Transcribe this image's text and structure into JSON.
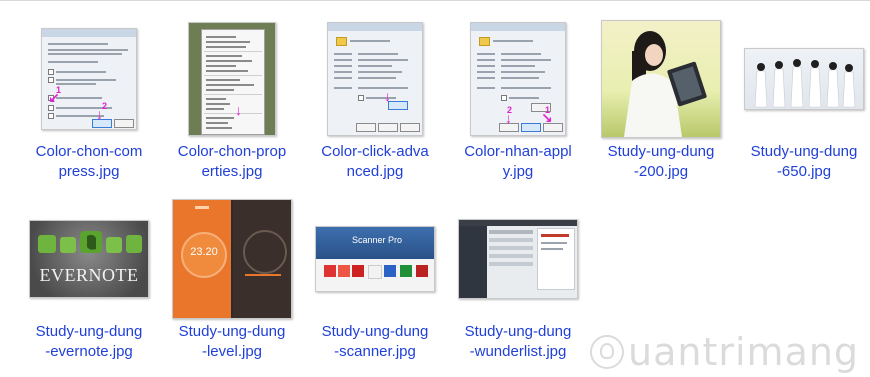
{
  "files": [
    {
      "name_line1": "Color-chon-com",
      "name_line2": "press.jpg",
      "icon": "image-file-icon"
    },
    {
      "name_line1": "Color-chon-prop",
      "name_line2": "erties.jpg",
      "icon": "image-file-icon"
    },
    {
      "name_line1": "Color-click-adva",
      "name_line2": "nced.jpg",
      "icon": "image-file-icon"
    },
    {
      "name_line1": "Color-nhan-appl",
      "name_line2": "y.jpg",
      "icon": "image-file-icon"
    },
    {
      "name_line1": "Study-ung-dung",
      "name_line2": "-200.jpg",
      "icon": "image-file-icon"
    },
    {
      "name_line1": "Study-ung-dung",
      "name_line2": "-650.jpg",
      "icon": "image-file-icon"
    },
    {
      "name_line1": "Study-ung-dung",
      "name_line2": "-evernote.jpg",
      "icon": "image-file-icon"
    },
    {
      "name_line1": "Study-ung-dung",
      "name_line2": "-level.jpg",
      "icon": "image-file-icon"
    },
    {
      "name_line1": "Study-ung-dung",
      "name_line2": "-scanner.jpg",
      "icon": "image-file-icon"
    },
    {
      "name_line1": "Study-ung-dung",
      "name_line2": "-wunderlist.jpg",
      "icon": "image-file-icon"
    }
  ],
  "thumb_text": {
    "evernote": "EVERNOTE",
    "level_reading": "23.20",
    "scanner": "Scanner Pro",
    "arrow_num_1": "1",
    "arrow_num_2": "2"
  },
  "watermark": "uantrimang",
  "colors": {
    "label": "#2040d8",
    "arrow": "#e020d0",
    "background": "#ffffff"
  }
}
